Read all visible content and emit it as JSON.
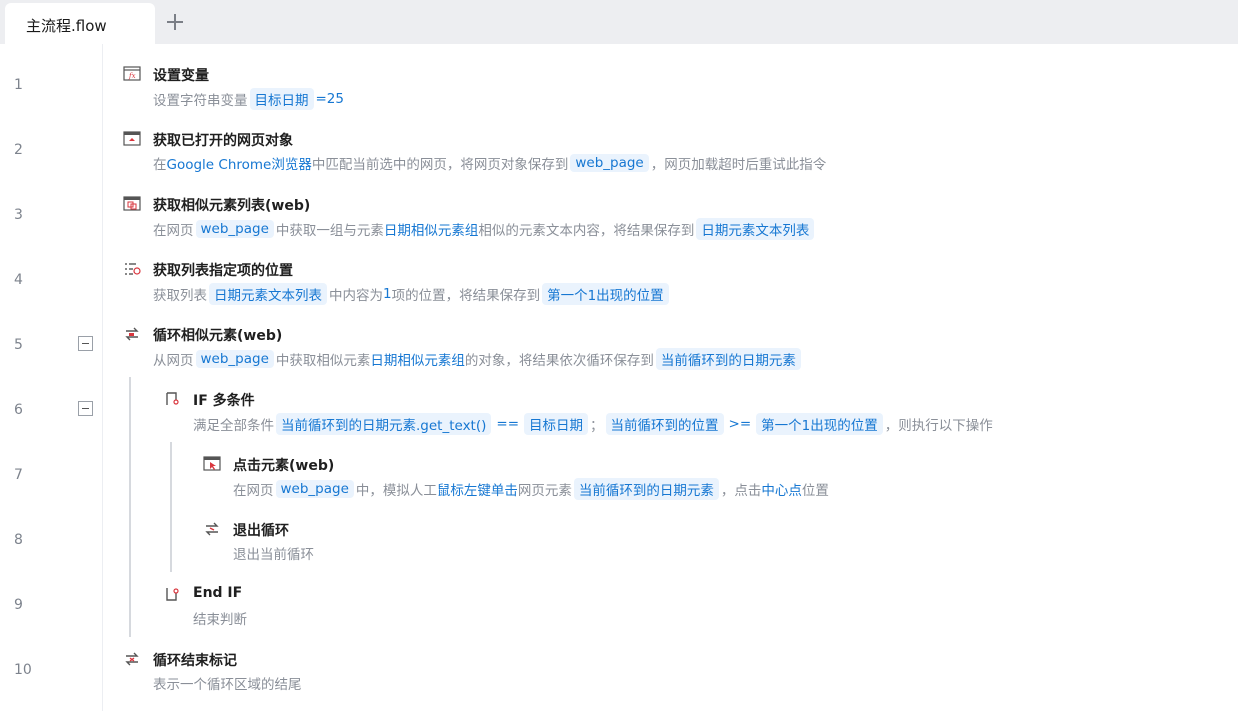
{
  "tabs": [
    {
      "label": "主流程.flow"
    }
  ],
  "line_numbers": [
    "1",
    "2",
    "3",
    "4",
    "5",
    "6",
    "7",
    "8",
    "9",
    "10"
  ],
  "steps": [
    {
      "icon": "set-variable-icon",
      "title": "设置变量",
      "desc": [
        "设置字符串变量",
        "目标日期",
        "=25"
      ]
    },
    {
      "icon": "web-page-icon",
      "title": "获取已打开的网页对象",
      "desc": [
        "在",
        "Google Chrome浏览器",
        "中匹配当前选中的网页，将网页对象保存到",
        "web_page",
        "，网页加载超时后重试此指令"
      ]
    },
    {
      "icon": "element-list-icon",
      "title": "获取相似元素列表(web)",
      "desc": [
        "在网页",
        "web_page",
        "中获取一组与元素",
        "日期相似元素组",
        "相似的元素文本内容，将结果保存到",
        "日期元素文本列表"
      ]
    },
    {
      "icon": "list-position-icon",
      "title": "获取列表指定项的位置",
      "desc": [
        "获取列表",
        "日期元素文本列表",
        "中内容为",
        "1",
        "项的位置，将结果保存到",
        "第一个1出现的位置"
      ]
    },
    {
      "icon": "loop-icon",
      "title": "循环相似元素(web)",
      "desc": [
        "从网页",
        "web_page",
        "中获取相似元素",
        "日期相似元素组",
        "的对象，将结果依次循环保存到",
        "当前循环到的日期元素"
      ]
    },
    {
      "icon": "if-icon",
      "title": "IF 多条件",
      "desc": [
        "满足全部条件",
        "当前循环到的日期元素.get_text()",
        "==",
        "目标日期",
        "；",
        "当前循环到的位置",
        ">=",
        "第一个1出现的位置",
        "，则执行以下操作"
      ]
    },
    {
      "icon": "click-element-icon",
      "title": "点击元素(web)",
      "desc": [
        "在网页",
        "web_page",
        "中，模拟人工",
        "鼠标左键单击",
        "网页元素",
        "当前循环到的日期元素",
        "，点击",
        "中心点",
        "位置"
      ]
    },
    {
      "icon": "exit-loop-icon",
      "title": "退出循环",
      "desc": [
        "退出当前循环"
      ]
    },
    {
      "icon": "end-if-icon",
      "title": "End IF",
      "desc": [
        "结束判断"
      ]
    },
    {
      "icon": "loop-end-icon",
      "title": "循环结束标记",
      "desc": [
        "表示一个循环区域的结尾"
      ]
    }
  ],
  "colors": {
    "accent": "#1677d2",
    "chip_bg": "#eaf3fd",
    "tab_bar": "#edeef1",
    "muted_text": "#8a8f98"
  }
}
